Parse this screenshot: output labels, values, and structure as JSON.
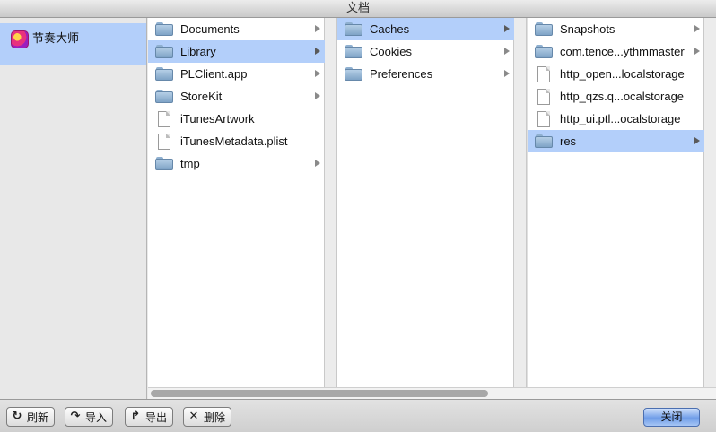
{
  "window": {
    "title": "文档"
  },
  "sidebar": {
    "items": [
      {
        "label": "节奏大师",
        "icon": "app-icon"
      }
    ]
  },
  "columns": [
    {
      "items": [
        {
          "label": "Documents",
          "icon": "folder-icon",
          "expandable": true,
          "selected": false
        },
        {
          "label": "Library",
          "icon": "folder-icon",
          "expandable": true,
          "selected": true
        },
        {
          "label": "PLClient.app",
          "icon": "folder-icon",
          "expandable": true,
          "selected": false
        },
        {
          "label": "StoreKit",
          "icon": "folder-icon",
          "expandable": true,
          "selected": false
        },
        {
          "label": "iTunesArtwork",
          "icon": "file-icon",
          "expandable": false,
          "selected": false
        },
        {
          "label": "iTunesMetadata.plist",
          "icon": "file-icon",
          "expandable": false,
          "selected": false
        },
        {
          "label": "tmp",
          "icon": "folder-icon",
          "expandable": true,
          "selected": false
        }
      ]
    },
    {
      "items": [
        {
          "label": "Caches",
          "icon": "folder-icon",
          "expandable": true,
          "selected": true
        },
        {
          "label": "Cookies",
          "icon": "folder-icon",
          "expandable": true,
          "selected": false
        },
        {
          "label": "Preferences",
          "icon": "folder-icon",
          "expandable": true,
          "selected": false
        }
      ]
    },
    {
      "items": [
        {
          "label": "Snapshots",
          "icon": "folder-icon",
          "expandable": true,
          "selected": false
        },
        {
          "label": "com.tence...ythmmaster",
          "icon": "folder-icon",
          "expandable": true,
          "selected": false
        },
        {
          "label": "http_open...localstorage",
          "icon": "file-icon",
          "expandable": false,
          "selected": false
        },
        {
          "label": "http_qzs.q...ocalstorage",
          "icon": "file-icon",
          "expandable": false,
          "selected": false
        },
        {
          "label": "http_ui.ptl...ocalstorage",
          "icon": "file-icon",
          "expandable": false,
          "selected": false
        },
        {
          "label": "res",
          "icon": "folder-icon",
          "expandable": true,
          "selected": true
        }
      ]
    }
  ],
  "toolbar": {
    "refresh_label": "刷新",
    "import_label": "导入",
    "export_label": "导出",
    "delete_label": "删除",
    "close_label": "关闭"
  }
}
